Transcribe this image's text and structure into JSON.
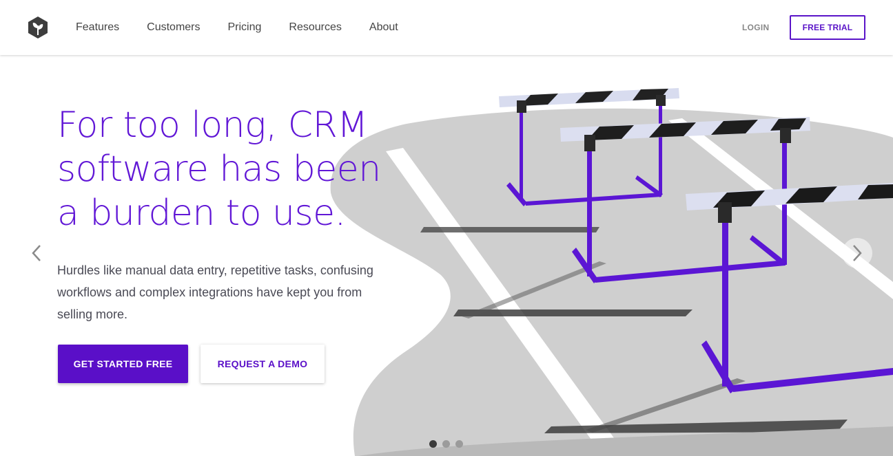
{
  "nav": {
    "items": [
      {
        "label": "Features"
      },
      {
        "label": "Customers"
      },
      {
        "label": "Pricing"
      },
      {
        "label": "Resources"
      },
      {
        "label": "About"
      }
    ],
    "login_label": "LOGIN",
    "free_trial_label": "FREE TRIAL"
  },
  "hero": {
    "headline": "For too long, CRM software has been a burden to use.",
    "subtext": "Hurdles like manual data entry, repetitive tasks, confusing workflows and complex integrations have kept you from selling more.",
    "primary_cta": "GET STARTED FREE",
    "secondary_cta": "REQUEST A DEMO"
  },
  "carousel": {
    "slide_count": 3,
    "active_slide": 1
  },
  "icons": {
    "logo": "leaf-hexagon-logo-icon",
    "prev": "chevron-left-icon",
    "next": "chevron-right-icon"
  },
  "colors": {
    "brand_purple": "#5a0fc8",
    "headline_purple": "#6117d6",
    "track_gray": "#cfcfcf",
    "hurdle_purple": "#5b16d4"
  }
}
